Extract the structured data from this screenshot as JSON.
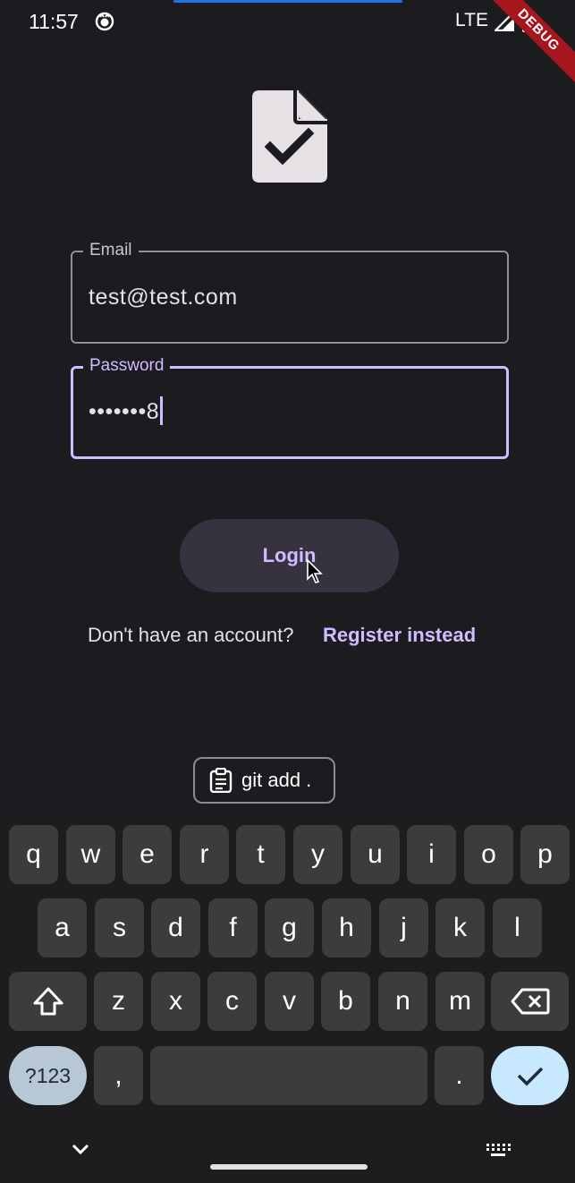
{
  "status_bar": {
    "time": "11:57",
    "network": "LTE",
    "debug_label": "DEBUG"
  },
  "form": {
    "email_label": "Email",
    "email_value": "test@test.com",
    "password_label": "Password",
    "password_value": "•••••••8"
  },
  "login_button": {
    "label": "Login"
  },
  "register": {
    "prompt": "Don't have an account?",
    "link": "Register instead"
  },
  "suggestion": {
    "text": "git add ."
  },
  "keyboard": {
    "row1": [
      "q",
      "w",
      "e",
      "r",
      "t",
      "y",
      "u",
      "i",
      "o",
      "p"
    ],
    "row2": [
      "a",
      "s",
      "d",
      "f",
      "g",
      "h",
      "j",
      "k",
      "l"
    ],
    "row3": [
      "z",
      "x",
      "c",
      "v",
      "b",
      "n",
      "m"
    ],
    "symbols_label": "?123",
    "comma_label": ",",
    "period_label": "."
  },
  "colors": {
    "background": "#1c1b1f",
    "accent": "#d0bcff",
    "key": "#3c3c3e"
  }
}
